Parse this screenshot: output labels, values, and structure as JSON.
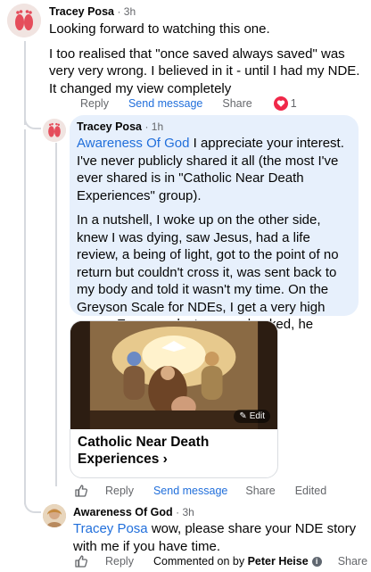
{
  "comments": {
    "root": {
      "author": "Tracey Posa",
      "time": "3h",
      "paragraphs": [
        "Looking forward to watching this one.",
        "I too realised that \"once saved always saved\" was very very wrong. I believed in it - until I had my NDE. It changed my view completely"
      ],
      "actions": {
        "reply": "Reply",
        "send": "Send message",
        "share": "Share"
      },
      "reaction_count": "1"
    },
    "reply1": {
      "author": "Tracey Posa",
      "time": "1h",
      "mention": "Awareness Of God",
      "text1": " I appreciate your interest. I've never publicly shared it all (the most I've ever shared is in \"Catholic Near Death Experiences\" group).",
      "text2": "In a nutshell, I woke up on the other side, knew I was dying, saw Jesus, had a life review, a being of light, got to the point of no return but couldn't cross it, was sent back to my body and told it wasn't my time. On the Greyson Scale for NDEs, I get a very high score. Even my doctor was shocked, he remarked that I'd actually seen it",
      "card": {
        "title": "Catholic Near Death Experiences",
        "chevron": "›",
        "edit_label": "Edit"
      },
      "actions": {
        "reply": "Reply",
        "send": "Send message",
        "share": "Share",
        "edited": "Edited"
      }
    },
    "reply2": {
      "author": "Awareness Of God",
      "time": "3h",
      "mention": "Tracey Posa",
      "text": " wow, please share your NDE story with me if you have time.",
      "actions": {
        "reply": "Reply",
        "commented_by_prefix": "Commented on by ",
        "commented_by_name": "Peter Heise",
        "info": "i",
        "share": "Share"
      }
    }
  },
  "colors": {
    "link": "#216fdb",
    "bubble": "#e7f0fc",
    "muted": "#65676b",
    "heart": "#f02849"
  },
  "icons": [
    "feet-avatar",
    "avatar-photo",
    "thumbs-up-icon",
    "heart-reaction-icon",
    "edit-icon",
    "info-icon"
  ]
}
